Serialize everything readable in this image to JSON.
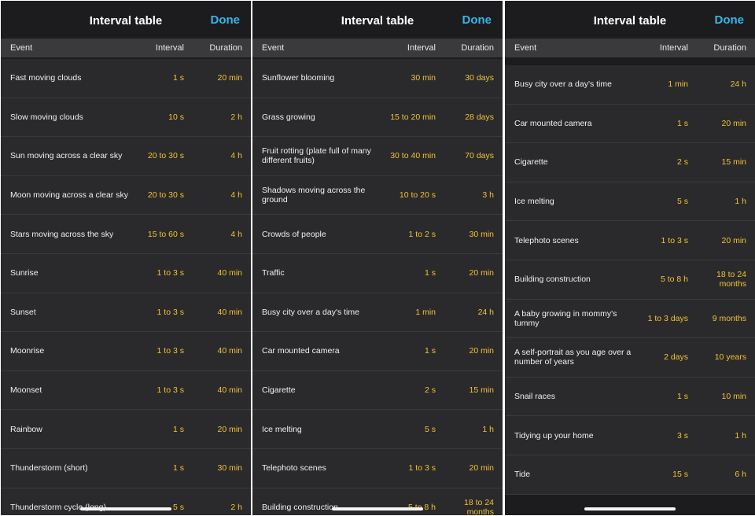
{
  "panels": [
    {
      "title": "Interval table",
      "done_label": "Done",
      "columns": {
        "event": "Event",
        "interval": "Interval",
        "duration": "Duration"
      },
      "rows": [
        {
          "event": "Fast moving clouds",
          "interval": "1 s",
          "duration": "20 min"
        },
        {
          "event": "Slow moving clouds",
          "interval": "10 s",
          "duration": "2 h"
        },
        {
          "event": "Sun moving across a clear sky",
          "interval": "20 to 30 s",
          "duration": "4 h"
        },
        {
          "event": "Moon moving across a clear sky",
          "interval": "20 to 30 s",
          "duration": "4 h"
        },
        {
          "event": "Stars moving across the sky",
          "interval": "15 to 60 s",
          "duration": "4 h"
        },
        {
          "event": "Sunrise",
          "interval": "1 to 3 s",
          "duration": "40 min"
        },
        {
          "event": "Sunset",
          "interval": "1 to 3 s",
          "duration": "40 min"
        },
        {
          "event": "Moonrise",
          "interval": "1 to 3 s",
          "duration": "40 min"
        },
        {
          "event": "Moonset",
          "interval": "1 to 3 s",
          "duration": "40 min"
        },
        {
          "event": "Rainbow",
          "interval": "1 s",
          "duration": "20 min"
        },
        {
          "event": "Thunderstorm (short)",
          "interval": "1 s",
          "duration": "30 min"
        },
        {
          "event": "Thunderstorm cycle (long)",
          "interval": "5 s",
          "duration": "2 h"
        }
      ]
    },
    {
      "title": "Interval table",
      "done_label": "Done",
      "columns": {
        "event": "Event",
        "interval": "Interval",
        "duration": "Duration"
      },
      "rows": [
        {
          "event": "Sunflower blooming",
          "interval": "30 min",
          "duration": "30 days"
        },
        {
          "event": "Grass growing",
          "interval": "15 to 20 min",
          "duration": "28 days"
        },
        {
          "event": "Fruit rotting (plate full of many different fruits)",
          "interval": "30 to 40 min",
          "duration": "70 days"
        },
        {
          "event": "Shadows moving across the ground",
          "interval": "10 to 20 s",
          "duration": "3 h"
        },
        {
          "event": "Crowds of people",
          "interval": "1 to 2 s",
          "duration": "30 min"
        },
        {
          "event": "Traffic",
          "interval": "1 s",
          "duration": "20 min"
        },
        {
          "event": "Busy city over a day's time",
          "interval": "1 min",
          "duration": "24 h"
        },
        {
          "event": "Car mounted camera",
          "interval": "1 s",
          "duration": "20 min"
        },
        {
          "event": "Cigarette",
          "interval": "2 s",
          "duration": "15 min"
        },
        {
          "event": "Ice melting",
          "interval": "5 s",
          "duration": "1 h"
        },
        {
          "event": "Telephoto scenes",
          "interval": "1 to 3 s",
          "duration": "20 min"
        },
        {
          "event": "Building construction",
          "interval": "5 to 8 h",
          "duration": "18 to 24 months"
        }
      ]
    },
    {
      "title": "Interval table",
      "done_label": "Done",
      "columns": {
        "event": "Event",
        "interval": "Interval",
        "duration": "Duration"
      },
      "rows": [
        {
          "event": "Busy city over a day's time",
          "interval": "1 min",
          "duration": "24 h"
        },
        {
          "event": "Car mounted camera",
          "interval": "1 s",
          "duration": "20 min"
        },
        {
          "event": "Cigarette",
          "interval": "2 s",
          "duration": "15 min"
        },
        {
          "event": "Ice melting",
          "interval": "5 s",
          "duration": "1 h"
        },
        {
          "event": "Telephoto scenes",
          "interval": "1 to 3 s",
          "duration": "20 min"
        },
        {
          "event": "Building construction",
          "interval": "5 to 8 h",
          "duration": "18 to 24 months"
        },
        {
          "event": "A baby growing in mommy's tummy",
          "interval": "1 to 3 days",
          "duration": "9 months"
        },
        {
          "event": "A self-portrait as you age over a number of years",
          "interval": "2 days",
          "duration": "10 years"
        },
        {
          "event": "Snail races",
          "interval": "1 s",
          "duration": "10 min"
        },
        {
          "event": "Tidying up your home",
          "interval": "3 s",
          "duration": "1 h"
        },
        {
          "event": "Tide",
          "interval": "15 s",
          "duration": "6 h"
        }
      ]
    }
  ]
}
